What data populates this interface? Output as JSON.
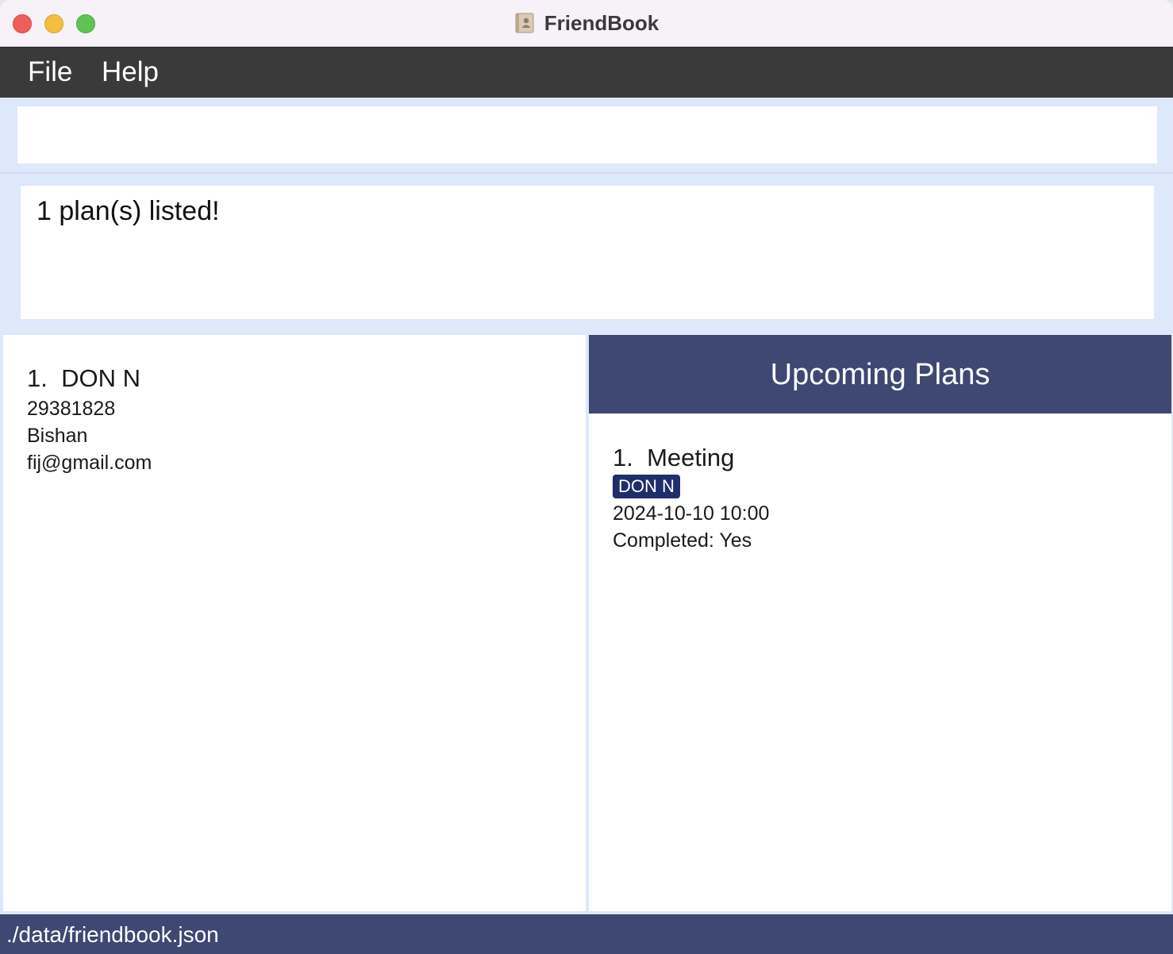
{
  "window": {
    "title": "FriendBook"
  },
  "menu": {
    "file": "File",
    "help": "Help"
  },
  "command": {
    "value": "",
    "placeholder": ""
  },
  "result": {
    "message": "1 plan(s) listed!"
  },
  "persons": [
    {
      "index": "1.",
      "name": "DON N",
      "phone": "29381828",
      "address": "Bishan",
      "email": "fij@gmail.com"
    }
  ],
  "plans": {
    "header": "Upcoming Plans",
    "items": [
      {
        "index": "1.",
        "title": "Meeting",
        "tag": "DON N",
        "datetime": "2024-10-10 10:00",
        "completed": "Completed: Yes"
      }
    ]
  },
  "status": {
    "path": "./data/friendbook.json"
  },
  "colors": {
    "menubar": "#3a3a3a",
    "accent": "#3e4872",
    "tag": "#1f2d6a",
    "background": "#dde8fb"
  }
}
